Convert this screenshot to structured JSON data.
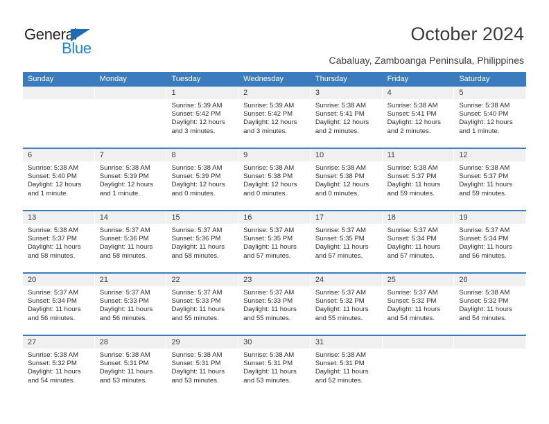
{
  "brand": {
    "name_top": "General",
    "name_bottom": "Blue",
    "triangle_color": "#1f6cb4",
    "blue_color": "#1c84d6"
  },
  "header": {
    "title": "October 2024",
    "subtitle": "Cabaluay, Zamboanga Peninsula, Philippines"
  },
  "theme": {
    "header_blue": "#3a7cbe",
    "daystrip_gray": "#f0f0f0",
    "text_dark": "#3b3b3b"
  },
  "weekdays": [
    "Sunday",
    "Monday",
    "Tuesday",
    "Wednesday",
    "Thursday",
    "Friday",
    "Saturday"
  ],
  "weeks": [
    [
      {
        "day": "",
        "empty": true
      },
      {
        "day": "",
        "empty": true
      },
      {
        "day": "1",
        "sunrise": "Sunrise: 5:39 AM",
        "sunset": "Sunset: 5:42 PM",
        "daylight1": "Daylight: 12 hours",
        "daylight2": "and 3 minutes."
      },
      {
        "day": "2",
        "sunrise": "Sunrise: 5:39 AM",
        "sunset": "Sunset: 5:42 PM",
        "daylight1": "Daylight: 12 hours",
        "daylight2": "and 3 minutes."
      },
      {
        "day": "3",
        "sunrise": "Sunrise: 5:38 AM",
        "sunset": "Sunset: 5:41 PM",
        "daylight1": "Daylight: 12 hours",
        "daylight2": "and 2 minutes."
      },
      {
        "day": "4",
        "sunrise": "Sunrise: 5:38 AM",
        "sunset": "Sunset: 5:41 PM",
        "daylight1": "Daylight: 12 hours",
        "daylight2": "and 2 minutes."
      },
      {
        "day": "5",
        "sunrise": "Sunrise: 5:38 AM",
        "sunset": "Sunset: 5:40 PM",
        "daylight1": "Daylight: 12 hours",
        "daylight2": "and 1 minute."
      }
    ],
    [
      {
        "day": "6",
        "sunrise": "Sunrise: 5:38 AM",
        "sunset": "Sunset: 5:40 PM",
        "daylight1": "Daylight: 12 hours",
        "daylight2": "and 1 minute."
      },
      {
        "day": "7",
        "sunrise": "Sunrise: 5:38 AM",
        "sunset": "Sunset: 5:39 PM",
        "daylight1": "Daylight: 12 hours",
        "daylight2": "and 1 minute."
      },
      {
        "day": "8",
        "sunrise": "Sunrise: 5:38 AM",
        "sunset": "Sunset: 5:39 PM",
        "daylight1": "Daylight: 12 hours",
        "daylight2": "and 0 minutes."
      },
      {
        "day": "9",
        "sunrise": "Sunrise: 5:38 AM",
        "sunset": "Sunset: 5:38 PM",
        "daylight1": "Daylight: 12 hours",
        "daylight2": "and 0 minutes."
      },
      {
        "day": "10",
        "sunrise": "Sunrise: 5:38 AM",
        "sunset": "Sunset: 5:38 PM",
        "daylight1": "Daylight: 12 hours",
        "daylight2": "and 0 minutes."
      },
      {
        "day": "11",
        "sunrise": "Sunrise: 5:38 AM",
        "sunset": "Sunset: 5:37 PM",
        "daylight1": "Daylight: 11 hours",
        "daylight2": "and 59 minutes."
      },
      {
        "day": "12",
        "sunrise": "Sunrise: 5:38 AM",
        "sunset": "Sunset: 5:37 PM",
        "daylight1": "Daylight: 11 hours",
        "daylight2": "and 59 minutes."
      }
    ],
    [
      {
        "day": "13",
        "sunrise": "Sunrise: 5:38 AM",
        "sunset": "Sunset: 5:37 PM",
        "daylight1": "Daylight: 11 hours",
        "daylight2": "and 58 minutes."
      },
      {
        "day": "14",
        "sunrise": "Sunrise: 5:37 AM",
        "sunset": "Sunset: 5:36 PM",
        "daylight1": "Daylight: 11 hours",
        "daylight2": "and 58 minutes."
      },
      {
        "day": "15",
        "sunrise": "Sunrise: 5:37 AM",
        "sunset": "Sunset: 5:36 PM",
        "daylight1": "Daylight: 11 hours",
        "daylight2": "and 58 minutes."
      },
      {
        "day": "16",
        "sunrise": "Sunrise: 5:37 AM",
        "sunset": "Sunset: 5:35 PM",
        "daylight1": "Daylight: 11 hours",
        "daylight2": "and 57 minutes."
      },
      {
        "day": "17",
        "sunrise": "Sunrise: 5:37 AM",
        "sunset": "Sunset: 5:35 PM",
        "daylight1": "Daylight: 11 hours",
        "daylight2": "and 57 minutes."
      },
      {
        "day": "18",
        "sunrise": "Sunrise: 5:37 AM",
        "sunset": "Sunset: 5:34 PM",
        "daylight1": "Daylight: 11 hours",
        "daylight2": "and 57 minutes."
      },
      {
        "day": "19",
        "sunrise": "Sunrise: 5:37 AM",
        "sunset": "Sunset: 5:34 PM",
        "daylight1": "Daylight: 11 hours",
        "daylight2": "and 56 minutes."
      }
    ],
    [
      {
        "day": "20",
        "sunrise": "Sunrise: 5:37 AM",
        "sunset": "Sunset: 5:34 PM",
        "daylight1": "Daylight: 11 hours",
        "daylight2": "and 56 minutes."
      },
      {
        "day": "21",
        "sunrise": "Sunrise: 5:37 AM",
        "sunset": "Sunset: 5:33 PM",
        "daylight1": "Daylight: 11 hours",
        "daylight2": "and 56 minutes."
      },
      {
        "day": "22",
        "sunrise": "Sunrise: 5:37 AM",
        "sunset": "Sunset: 5:33 PM",
        "daylight1": "Daylight: 11 hours",
        "daylight2": "and 55 minutes."
      },
      {
        "day": "23",
        "sunrise": "Sunrise: 5:37 AM",
        "sunset": "Sunset: 5:33 PM",
        "daylight1": "Daylight: 11 hours",
        "daylight2": "and 55 minutes."
      },
      {
        "day": "24",
        "sunrise": "Sunrise: 5:37 AM",
        "sunset": "Sunset: 5:32 PM",
        "daylight1": "Daylight: 11 hours",
        "daylight2": "and 55 minutes."
      },
      {
        "day": "25",
        "sunrise": "Sunrise: 5:37 AM",
        "sunset": "Sunset: 5:32 PM",
        "daylight1": "Daylight: 11 hours",
        "daylight2": "and 54 minutes."
      },
      {
        "day": "26",
        "sunrise": "Sunrise: 5:38 AM",
        "sunset": "Sunset: 5:32 PM",
        "daylight1": "Daylight: 11 hours",
        "daylight2": "and 54 minutes."
      }
    ],
    [
      {
        "day": "27",
        "sunrise": "Sunrise: 5:38 AM",
        "sunset": "Sunset: 5:32 PM",
        "daylight1": "Daylight: 11 hours",
        "daylight2": "and 54 minutes."
      },
      {
        "day": "28",
        "sunrise": "Sunrise: 5:38 AM",
        "sunset": "Sunset: 5:31 PM",
        "daylight1": "Daylight: 11 hours",
        "daylight2": "and 53 minutes."
      },
      {
        "day": "29",
        "sunrise": "Sunrise: 5:38 AM",
        "sunset": "Sunset: 5:31 PM",
        "daylight1": "Daylight: 11 hours",
        "daylight2": "and 53 minutes."
      },
      {
        "day": "30",
        "sunrise": "Sunrise: 5:38 AM",
        "sunset": "Sunset: 5:31 PM",
        "daylight1": "Daylight: 11 hours",
        "daylight2": "and 53 minutes."
      },
      {
        "day": "31",
        "sunrise": "Sunrise: 5:38 AM",
        "sunset": "Sunset: 5:31 PM",
        "daylight1": "Daylight: 11 hours",
        "daylight2": "and 52 minutes."
      },
      {
        "day": "",
        "empty": true
      },
      {
        "day": "",
        "empty": true
      }
    ]
  ]
}
